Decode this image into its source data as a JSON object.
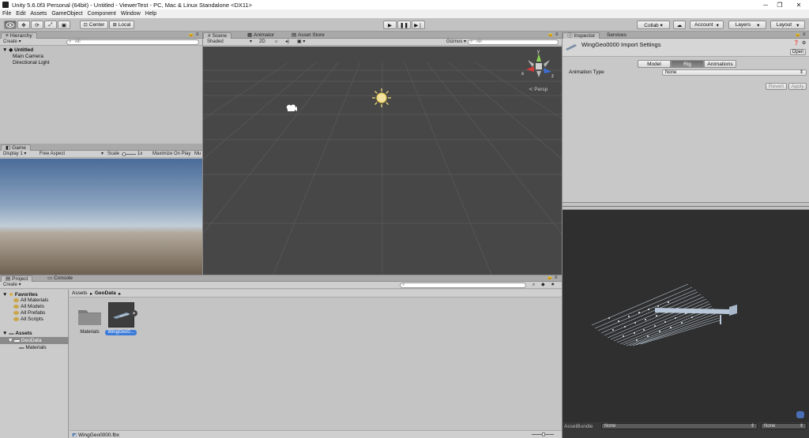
{
  "window": {
    "title": "Unity 5.6.0f3 Personal (64bit) - Untitled - ViewerTest - PC, Mac & Linux Standalone <DX11>",
    "minimize": "─",
    "restore": "❐",
    "close": "✕"
  },
  "menu": [
    "File",
    "Edit",
    "Assets",
    "GameObject",
    "Component",
    "Window",
    "Help"
  ],
  "toolbar": {
    "pivot": "Center",
    "space": "Local",
    "collab": "Collab ▾",
    "cloud": "☁",
    "account": "Account",
    "layers": "Layers",
    "layout": "Layout"
  },
  "hierarchy": {
    "tab": "Hierarchy",
    "create": "Create ▾",
    "search_placeholder": "All",
    "scene": "Untitled",
    "items": [
      "Main Camera",
      "Directional Light"
    ]
  },
  "scene": {
    "tabs": [
      "Scene",
      "Animator",
      "Asset Store"
    ],
    "shading": "Shaded",
    "mode_2d": "2D",
    "gizmos": "Gizmos ▾",
    "gizmo_search": "All",
    "persp": "Persp"
  },
  "game": {
    "tab": "Game",
    "display": "Display 1",
    "aspect": "Free Aspect",
    "scale_label": "Scale",
    "scale_value": "1x",
    "maximize": "Maximize On Play",
    "mute": "Mu"
  },
  "inspector": {
    "tabs": [
      "Inspector",
      "Services"
    ],
    "title": "WingGeo0000 Import Settings",
    "open": "Open",
    "import_tabs": [
      "Model",
      "Rig",
      "Animations"
    ],
    "animation_type_label": "Animation Type",
    "animation_type_value": "None",
    "revert": "Revert",
    "apply": "Apply"
  },
  "preview": {
    "assetbundle_label": "AssetBundle",
    "bundle": "None",
    "variant": "None"
  },
  "project": {
    "tabs": [
      "Project",
      "Console"
    ],
    "create": "Create ▾",
    "favorites": "Favorites",
    "favorite_items": [
      "All Materials",
      "All Models",
      "All Prefabs",
      "All Scripts"
    ],
    "assets": "Assets",
    "geodata": "GeoData",
    "materials_sub": "Materials",
    "breadcrumb": [
      "Assets",
      "GeoData"
    ],
    "grid_items": [
      "Materials",
      "WingGeo0..."
    ],
    "selected_file": "WingGeo0000.fbx"
  },
  "colors": {
    "selection": "#3d7bd8",
    "scene_bg": "#474747",
    "toolbar": "#c2c2c2"
  }
}
